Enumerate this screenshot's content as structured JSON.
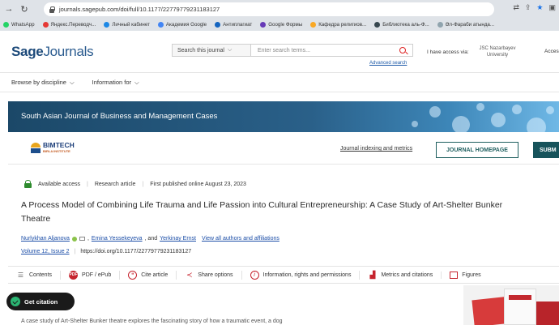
{
  "browser": {
    "url": "journals.sagepub.com/doi/full/10.1177/22779779231183127",
    "bookmarks": [
      {
        "label": "WhatsApp",
        "color": "#25d366"
      },
      {
        "label": "Яндекс.Переводч...",
        "color": "#e53935"
      },
      {
        "label": "Личный кабинет",
        "color": "#1e88e5"
      },
      {
        "label": "Академия Google",
        "color": "#4285f4"
      },
      {
        "label": "Антиплагиат",
        "color": "#1565c0"
      },
      {
        "label": "Google Формы",
        "color": "#673ab7"
      },
      {
        "label": "Кафедра религиов...",
        "color": "#f9a825"
      },
      {
        "label": "Библиотека аль-Ф...",
        "color": "#37474f"
      },
      {
        "label": "Әл-Фараби атында...",
        "color": "#90a4ae"
      }
    ]
  },
  "site": {
    "logo_sage": "Sage",
    "logo_journals": "Journals",
    "search_scope": "Search this journal",
    "search_placeholder": "Enter search terms...",
    "advanced_search": "Advanced search",
    "access_via": "I have access via:",
    "institution": "JSC Nazarbayev University",
    "access_cut": "Acces",
    "browse": "Browse by discipline",
    "info_for": "Information for"
  },
  "journal": {
    "title": "South Asian Journal of Business and Management Cases",
    "partner_logo": "BIMTECH",
    "partner_sub": "BIRLA INSTITUTE",
    "indexing_link": "Journal indexing and metrics",
    "homepage_button": "JOURNAL HOMEPAGE",
    "submit_button": "SUBM"
  },
  "article": {
    "access": "Available access",
    "type": "Research article",
    "published": "First published online August 23, 2023",
    "title": "A Process Model of Combining Life Trauma and Life Passion into Cultural Entrepreneurship: A Case Study of Art-Shelter Bunker Theatre",
    "authors": [
      "Nurlykhan Aljanova",
      "Emina Yessekeyeva",
      "Yerkinay Ernst"
    ],
    "author_sep_1": ",",
    "author_sep_2": ", and",
    "view_all": "View all authors and affiliations",
    "volume": "Volume 12, Issue 2",
    "doi": "https://doi.org/10.1177/22779779231183127",
    "abstract_start": "A case study of Art-Shelter Bunker theatre explores the fascinating story of how a traumatic event, a dog"
  },
  "tools": [
    {
      "label": "Contents",
      "icon": "list-icon"
    },
    {
      "label": "PDF / ePub",
      "icon": "pdf-icon"
    },
    {
      "label": "Cite article",
      "icon": "cite-icon"
    },
    {
      "label": "Share options",
      "icon": "share-icon"
    },
    {
      "label": "Information, rights and permissions",
      "icon": "info-icon"
    },
    {
      "label": "Metrics and citations",
      "icon": "metrics-icon"
    },
    {
      "label": "Figures",
      "icon": "figures-icon"
    }
  ],
  "get_citation": "Get citation",
  "colors": {
    "brand_blue": "#1d4a7a",
    "accent_red": "#c6242e",
    "teal": "#17535b",
    "link": "#1d4fa8",
    "open_access_green": "#2e8b2e"
  }
}
